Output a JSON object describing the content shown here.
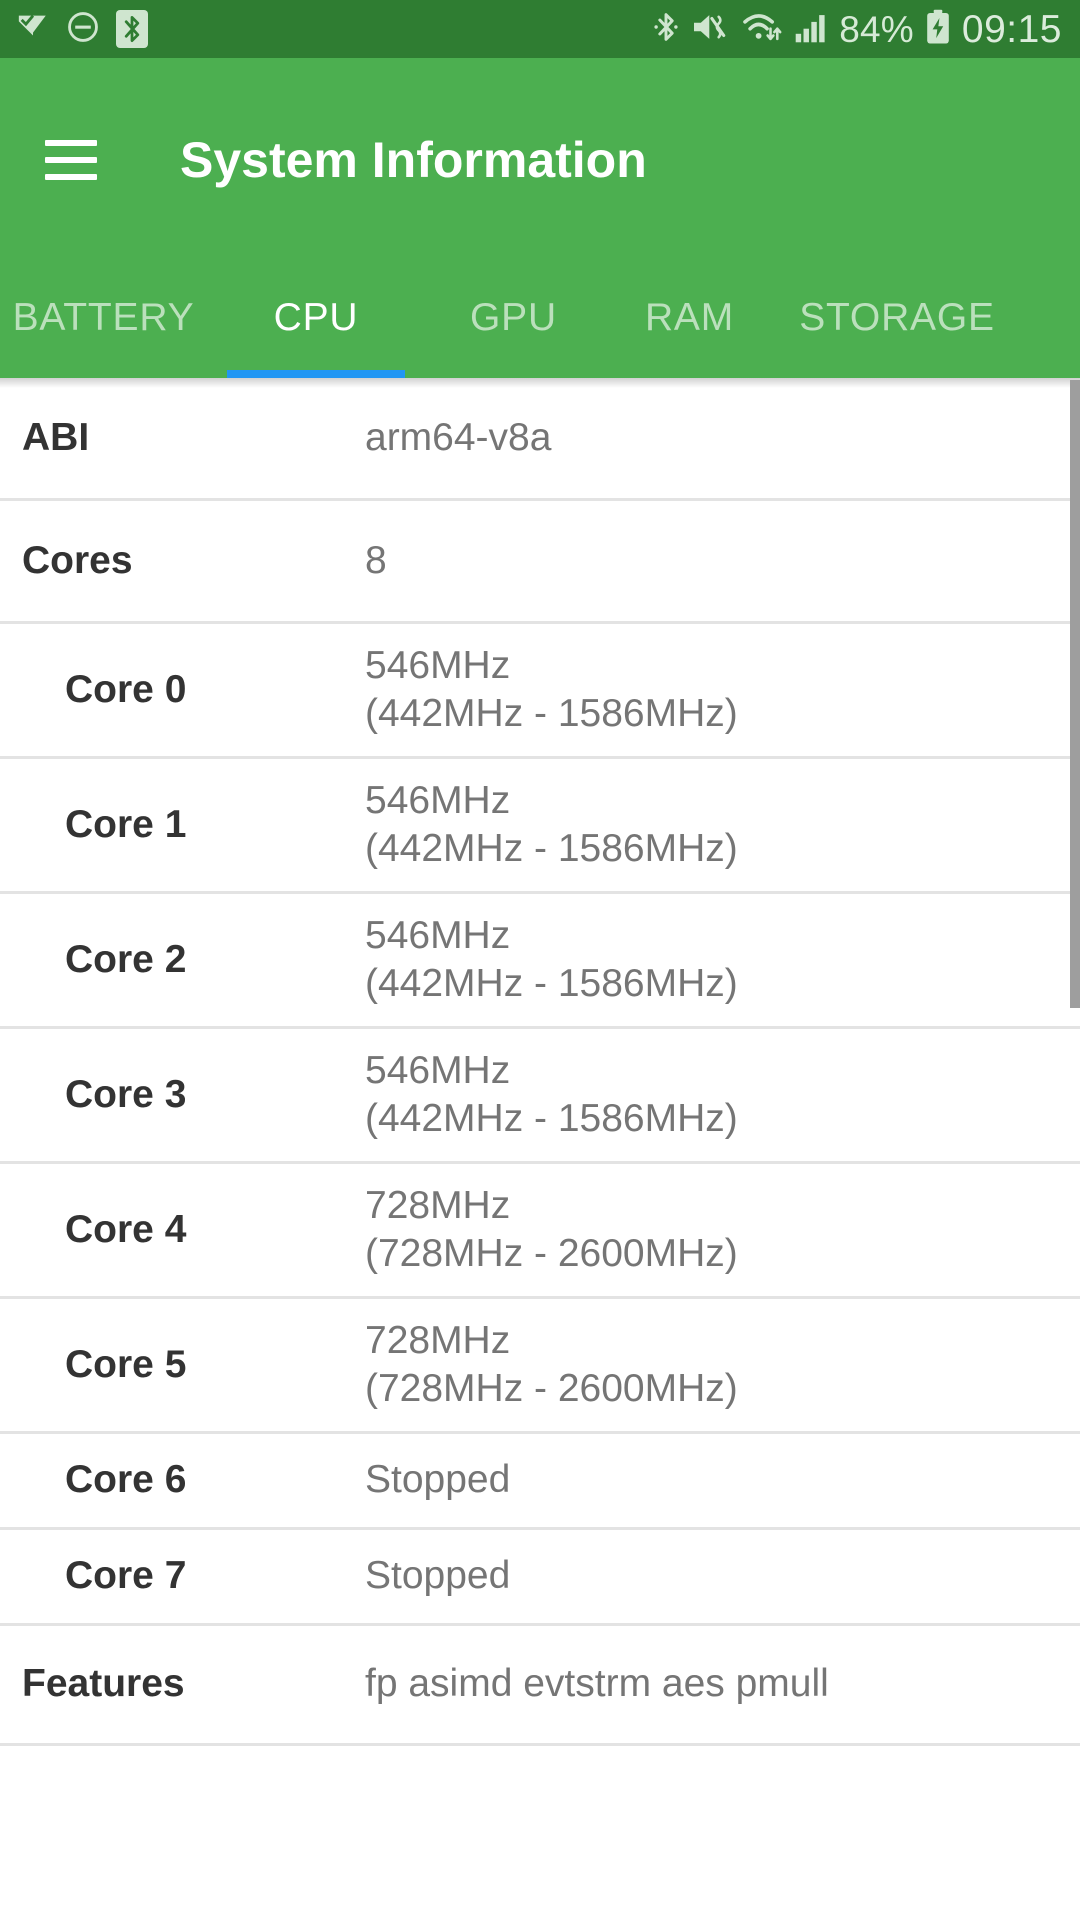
{
  "status_bar": {
    "background_color": "#2f7d32",
    "left_icons": [
      {
        "name": "download-check-icon",
        "glyph": "check-arrow"
      },
      {
        "name": "do-not-disturb-icon",
        "glyph": "minus-circle"
      },
      {
        "name": "bluetooth-chip-icon",
        "glyph": "bluetooth"
      }
    ],
    "right_icons": [
      {
        "name": "bluetooth-connected-icon",
        "glyph": "bluetooth"
      },
      {
        "name": "mute-vibrate-icon",
        "glyph": "speaker-muted"
      },
      {
        "name": "wifi-transfer-icon",
        "glyph": "wifi"
      },
      {
        "name": "cellular-signal-icon",
        "glyph": "signal-bars"
      }
    ],
    "battery_percent": "84%",
    "battery_charging": true,
    "clock": "09:15"
  },
  "app_bar": {
    "background_color": "#4caf50",
    "menu_icon": "hamburger-menu-icon",
    "title": "System Information"
  },
  "tabs": {
    "indicator_color": "#2196f3",
    "active_index": 1,
    "items": [
      {
        "label": "BATTERY"
      },
      {
        "label": "CPU"
      },
      {
        "label": "GPU"
      },
      {
        "label": "RAM"
      },
      {
        "label": "STORAGE"
      }
    ]
  },
  "cpu_rows": [
    {
      "type": "single",
      "label": "ABI",
      "value": "arm64-v8a"
    },
    {
      "type": "single",
      "label": "Cores",
      "value": "8"
    },
    {
      "type": "sub",
      "label": "Core 0",
      "value_line1": "546MHz",
      "value_line2": "(442MHz - 1586MHz)"
    },
    {
      "type": "sub",
      "label": "Core 1",
      "value_line1": "546MHz",
      "value_line2": "(442MHz - 1586MHz)"
    },
    {
      "type": "sub",
      "label": "Core 2",
      "value_line1": "546MHz",
      "value_line2": "(442MHz - 1586MHz)"
    },
    {
      "type": "sub",
      "label": "Core 3",
      "value_line1": "546MHz",
      "value_line2": "(442MHz - 1586MHz)"
    },
    {
      "type": "sub",
      "label": "Core 4",
      "value_line1": "728MHz",
      "value_line2": "(728MHz - 2600MHz)"
    },
    {
      "type": "sub",
      "label": "Core 5",
      "value_line1": "728MHz",
      "value_line2": "(728MHz - 2600MHz)"
    },
    {
      "type": "sub",
      "label": "Core 6",
      "value_line1": "Stopped",
      "value_line2": ""
    },
    {
      "type": "sub",
      "label": "Core 7",
      "value_line1": "Stopped",
      "value_line2": ""
    },
    {
      "type": "clipped",
      "label": "Features",
      "value_line1": "fp asimd evtstrm aes pmull",
      "value_line2": ""
    }
  ],
  "scrollbar": {
    "visible": true
  }
}
